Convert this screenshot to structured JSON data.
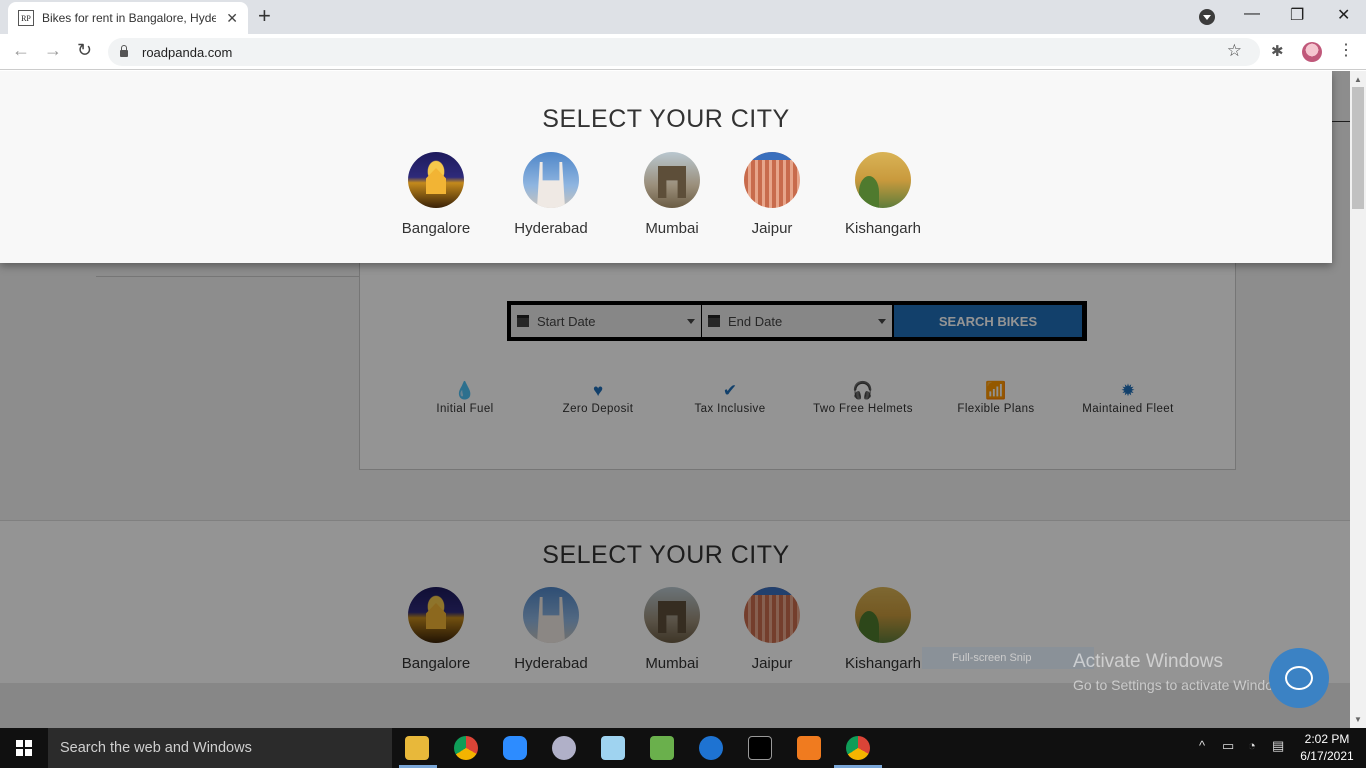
{
  "browser": {
    "tab_title": "Bikes for rent in Bangalore, Hyde",
    "favicon_text": "RP",
    "tab_close": "✕",
    "new_tab": "+",
    "url": "roadpanda.com",
    "window_controls": {
      "minimize": "—",
      "restore": "❐",
      "close": "✕"
    },
    "nav": {
      "back": "←",
      "forward": "→",
      "reload": "↻"
    },
    "bookmark_star": "☆",
    "extensions_icon": "puzzle-icon",
    "menu": "⋮"
  },
  "modal": {
    "title": "SELECT YOUR CITY",
    "cities": [
      {
        "name": "Bangalore"
      },
      {
        "name": "Hyderabad"
      },
      {
        "name": "Mumbai"
      },
      {
        "name": "Jaipur"
      },
      {
        "name": "Kishangarh"
      }
    ]
  },
  "search": {
    "start_date": "Start Date",
    "end_date": "End Date",
    "button": "SEARCH BIKES"
  },
  "features": [
    {
      "label": "Initial Fuel",
      "icon": "drop-icon",
      "glyph": "💧"
    },
    {
      "label": "Zero Deposit",
      "icon": "heart-icon",
      "glyph": "♥"
    },
    {
      "label": "Tax Inclusive",
      "icon": "check-icon",
      "glyph": "✔"
    },
    {
      "label": "Two Free Helmets",
      "icon": "headphones-icon",
      "glyph": "🎧"
    },
    {
      "label": "Flexible Plans",
      "icon": "signal-icon",
      "glyph": "📶"
    },
    {
      "label": "Maintained Fleet",
      "icon": "cog-icon",
      "glyph": "✹"
    }
  ],
  "section2": {
    "title": "SELECT YOUR CITY",
    "cities": [
      {
        "name": "Bangalore"
      },
      {
        "name": "Hyderabad"
      },
      {
        "name": "Mumbai"
      },
      {
        "name": "Jaipur"
      },
      {
        "name": "Kishangarh"
      }
    ]
  },
  "overlay": {
    "snip_label": "Full-screen Snip",
    "activate_title": "Activate Windows",
    "activate_sub": "Go to Settings to activate Windows."
  },
  "taskbar": {
    "search_placeholder": "Search the web and Windows",
    "time": "2:02 PM",
    "date": "6/17/2021",
    "tray_chevron": "^"
  },
  "colors": {
    "accent": "#1f6fb8",
    "chat": "#3b82c4"
  }
}
